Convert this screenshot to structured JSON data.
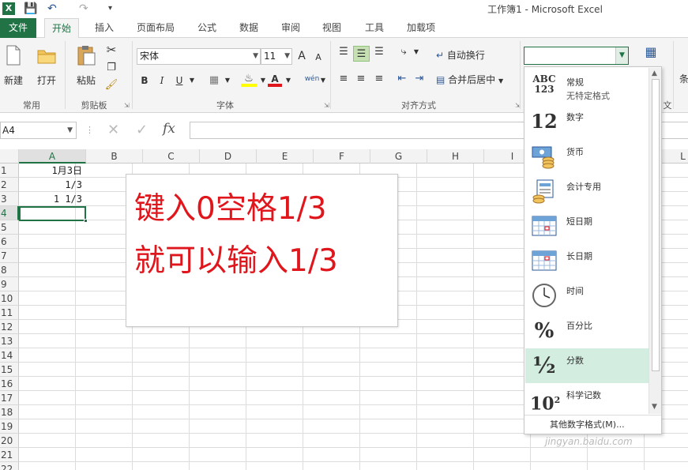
{
  "app": {
    "title": "工作簿1 - Microsoft Excel",
    "logo_letter": "X",
    "colors": {
      "brand": "#217346",
      "note_text": "#e0161d",
      "selected_item": "#d3ede0"
    }
  },
  "quick_access": {
    "icons": [
      "save-icon",
      "undo-icon",
      "redo-icon",
      "customize-icon"
    ]
  },
  "tabs": [
    {
      "label": "文件"
    },
    {
      "label": "开始"
    },
    {
      "label": "插入"
    },
    {
      "label": "页面布局"
    },
    {
      "label": "公式"
    },
    {
      "label": "数据"
    },
    {
      "label": "审阅"
    },
    {
      "label": "视图"
    },
    {
      "label": "工具"
    },
    {
      "label": "加载项"
    }
  ],
  "ribbon": {
    "common": {
      "new_label": "新建",
      "open_label": "打开",
      "group_label": "常用"
    },
    "clipboard": {
      "paste_label": "粘贴",
      "group_label": "剪贴板"
    },
    "font": {
      "name": "宋体",
      "size": "11",
      "group_label": "字体",
      "bold": "B",
      "italic": "I",
      "underline": "U",
      "grow": "A",
      "shrink": "A",
      "phonetic": "wén"
    },
    "alignment": {
      "wrap_label": "自动换行",
      "merge_label": "合并后居中",
      "group_label": "对齐方式"
    },
    "right_cut": {
      "cond_label": "条",
      "group_partial": "文"
    }
  },
  "formula_bar": {
    "name_box": "A4",
    "fx": "fx",
    "value": ""
  },
  "grid": {
    "columns": [
      "A",
      "B",
      "C",
      "D",
      "E",
      "F",
      "G",
      "H",
      "I",
      "",
      "",
      "L"
    ],
    "rows": [
      "1",
      "2",
      "3",
      "4",
      "5",
      "6",
      "7",
      "8",
      "9",
      "10",
      "11",
      "12",
      "13",
      "14",
      "15",
      "16",
      "17",
      "18",
      "19",
      "20",
      "21",
      "22"
    ],
    "cells": [
      {
        "ref": "A1",
        "value": "1月3日"
      },
      {
        "ref": "A2",
        "value": "1/3"
      },
      {
        "ref": "A3",
        "value": "1 1/3"
      }
    ],
    "selected": "A4"
  },
  "note": {
    "line1": "键入0空格1/3",
    "line2": "就可以输入1/3"
  },
  "number_format_menu": {
    "current_value": "",
    "items": [
      {
        "icon": "abc-123-icon",
        "icon_text": "ABC\n123",
        "label": "常规",
        "sub": "无特定格式"
      },
      {
        "icon": "number-12-icon",
        "icon_text": "12",
        "label": "数字",
        "sub": ""
      },
      {
        "icon": "currency-icon",
        "icon_text": "",
        "label": "货币",
        "sub": ""
      },
      {
        "icon": "accounting-icon",
        "icon_text": "",
        "label": "会计专用",
        "sub": ""
      },
      {
        "icon": "short-date-icon",
        "icon_text": "",
        "label": "短日期",
        "sub": ""
      },
      {
        "icon": "long-date-icon",
        "icon_text": "",
        "label": "长日期",
        "sub": ""
      },
      {
        "icon": "clock-icon",
        "icon_text": "",
        "label": "时间",
        "sub": ""
      },
      {
        "icon": "percent-icon",
        "icon_text": "%",
        "label": "百分比",
        "sub": ""
      },
      {
        "icon": "fraction-icon",
        "icon_text": "½",
        "label": "分数",
        "sub": ""
      },
      {
        "icon": "scientific-icon",
        "icon_text": "10²",
        "label": "科学记数",
        "sub": ""
      }
    ],
    "selected_index": 8,
    "more_label": "其他数字格式(M)..."
  },
  "watermark": "jingyan.baidu.com"
}
